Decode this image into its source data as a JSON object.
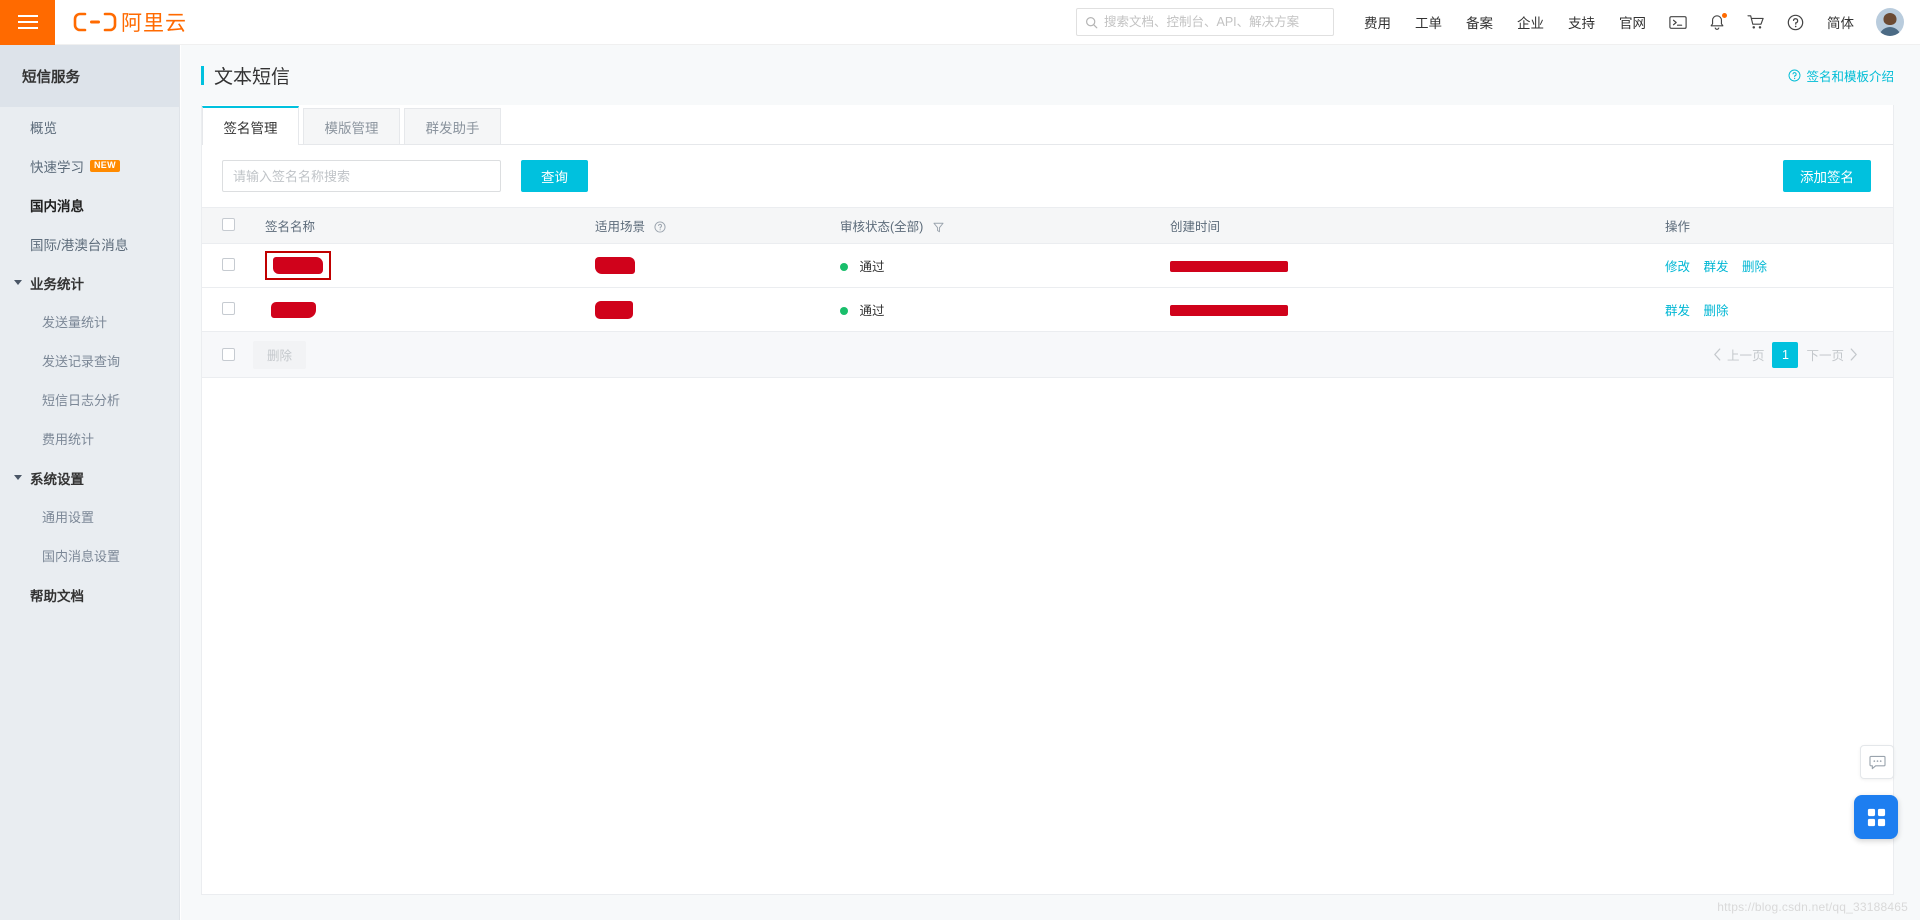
{
  "header": {
    "logo_text": "阿里云",
    "menu_icon": "hamburger-icon",
    "search": {
      "placeholder": "搜索文档、控制台、API、解决方案",
      "value": "",
      "icon": "search-icon"
    },
    "nav_links": [
      {
        "label": "费用"
      },
      {
        "label": "工单"
      },
      {
        "label": "备案"
      },
      {
        "label": "企业"
      },
      {
        "label": "支持"
      },
      {
        "label": "官网"
      }
    ],
    "icons": [
      {
        "name": "console-terminal-icon"
      },
      {
        "name": "bell-icon",
        "has_dot": true
      },
      {
        "name": "cart-icon"
      },
      {
        "name": "help-circle-icon"
      }
    ],
    "language": "简体",
    "avatar": "user-avatar"
  },
  "sidebar": {
    "title": "短信服务",
    "items": [
      {
        "label": "概览",
        "type": "item"
      },
      {
        "label": "快速学习",
        "type": "item",
        "badge": "NEW"
      },
      {
        "label": "国内消息",
        "type": "item",
        "active": true
      },
      {
        "label": "国际/港澳台消息",
        "type": "item"
      },
      {
        "label": "业务统计",
        "type": "group"
      },
      {
        "label": "发送量统计",
        "type": "sub"
      },
      {
        "label": "发送记录查询",
        "type": "sub"
      },
      {
        "label": "短信日志分析",
        "type": "sub"
      },
      {
        "label": "费用统计",
        "type": "sub"
      },
      {
        "label": "系统设置",
        "type": "group"
      },
      {
        "label": "通用设置",
        "type": "sub"
      },
      {
        "label": "国内消息设置",
        "type": "sub"
      },
      {
        "label": "帮助文档",
        "type": "plain"
      }
    ]
  },
  "page": {
    "title": "文本短信",
    "help_link": "签名和模板介绍",
    "tabs": [
      {
        "label": "签名管理",
        "active": true
      },
      {
        "label": "模版管理",
        "active": false
      },
      {
        "label": "群发助手",
        "active": false
      }
    ],
    "toolbar": {
      "search_placeholder": "请输入签名名称搜索",
      "search_value": "",
      "query_label": "查询",
      "add_label": "添加签名"
    },
    "table": {
      "columns": [
        {
          "key": "checkbox",
          "label": ""
        },
        {
          "key": "name",
          "label": "签名名称"
        },
        {
          "key": "scene",
          "label": "适用场景",
          "icon": "help-circle-icon"
        },
        {
          "key": "status",
          "label": "审核状态(全部)",
          "icon": "filter-icon"
        },
        {
          "key": "time",
          "label": "创建时间"
        },
        {
          "key": "actions",
          "label": "操作"
        }
      ],
      "rows": [
        {
          "name": "[redacted]",
          "name_highlighted": true,
          "scene": "[redacted]",
          "status": "通过",
          "status_color": "#19be6b",
          "time": "[redacted]",
          "actions": [
            "修改",
            "群发",
            "删除"
          ]
        },
        {
          "name": "[redacted]",
          "name_highlighted": false,
          "scene": "[redacted]",
          "status": "通过",
          "status_color": "#19be6b",
          "time": "[redacted]",
          "actions": [
            "群发",
            "删除"
          ]
        }
      ]
    },
    "footer": {
      "batch_delete_label": "删除",
      "prev_label": "上一页",
      "next_label": "下一页",
      "current_page": "1"
    }
  },
  "floating": {
    "chat_icon": "chat-bubble-icon",
    "apps_icon": "grid-apps-icon"
  },
  "watermark": "https://blog.csdn.net/qq_33188465",
  "colors": {
    "brand_orange": "#ff6a00",
    "accent_cyan": "#00c1de",
    "status_green": "#19be6b",
    "redaction_red": "#d0021b",
    "highlight_red": "#c00000",
    "apps_blue": "#1d7ef0"
  }
}
